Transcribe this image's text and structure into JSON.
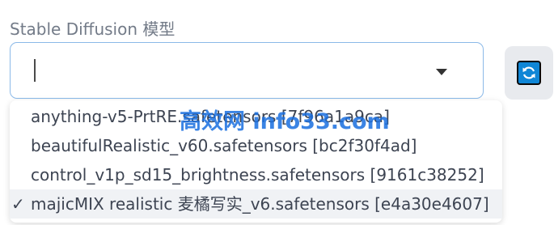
{
  "model_select": {
    "label": "Stable Diffusion 模型",
    "value": "",
    "options": [
      {
        "text": "anything-v5-PrtRE.safetensors [7f96a1a9ca]",
        "selected": false
      },
      {
        "text": "beautifulRealistic_v60.safetensors [bc2f30f4ad]",
        "selected": false
      },
      {
        "text": "control_v1p_sd15_brightness.safetensors [9161c38252]",
        "selected": false
      },
      {
        "text": "majicMIX realistic 麦橘写实_v6.safetensors [e4a30e4607]",
        "selected": true
      }
    ],
    "check_mark": "✓"
  },
  "refresh_button": {
    "icon": "refresh-icon",
    "color": "#0f86d6"
  },
  "watermark": "高效网 info33.com"
}
